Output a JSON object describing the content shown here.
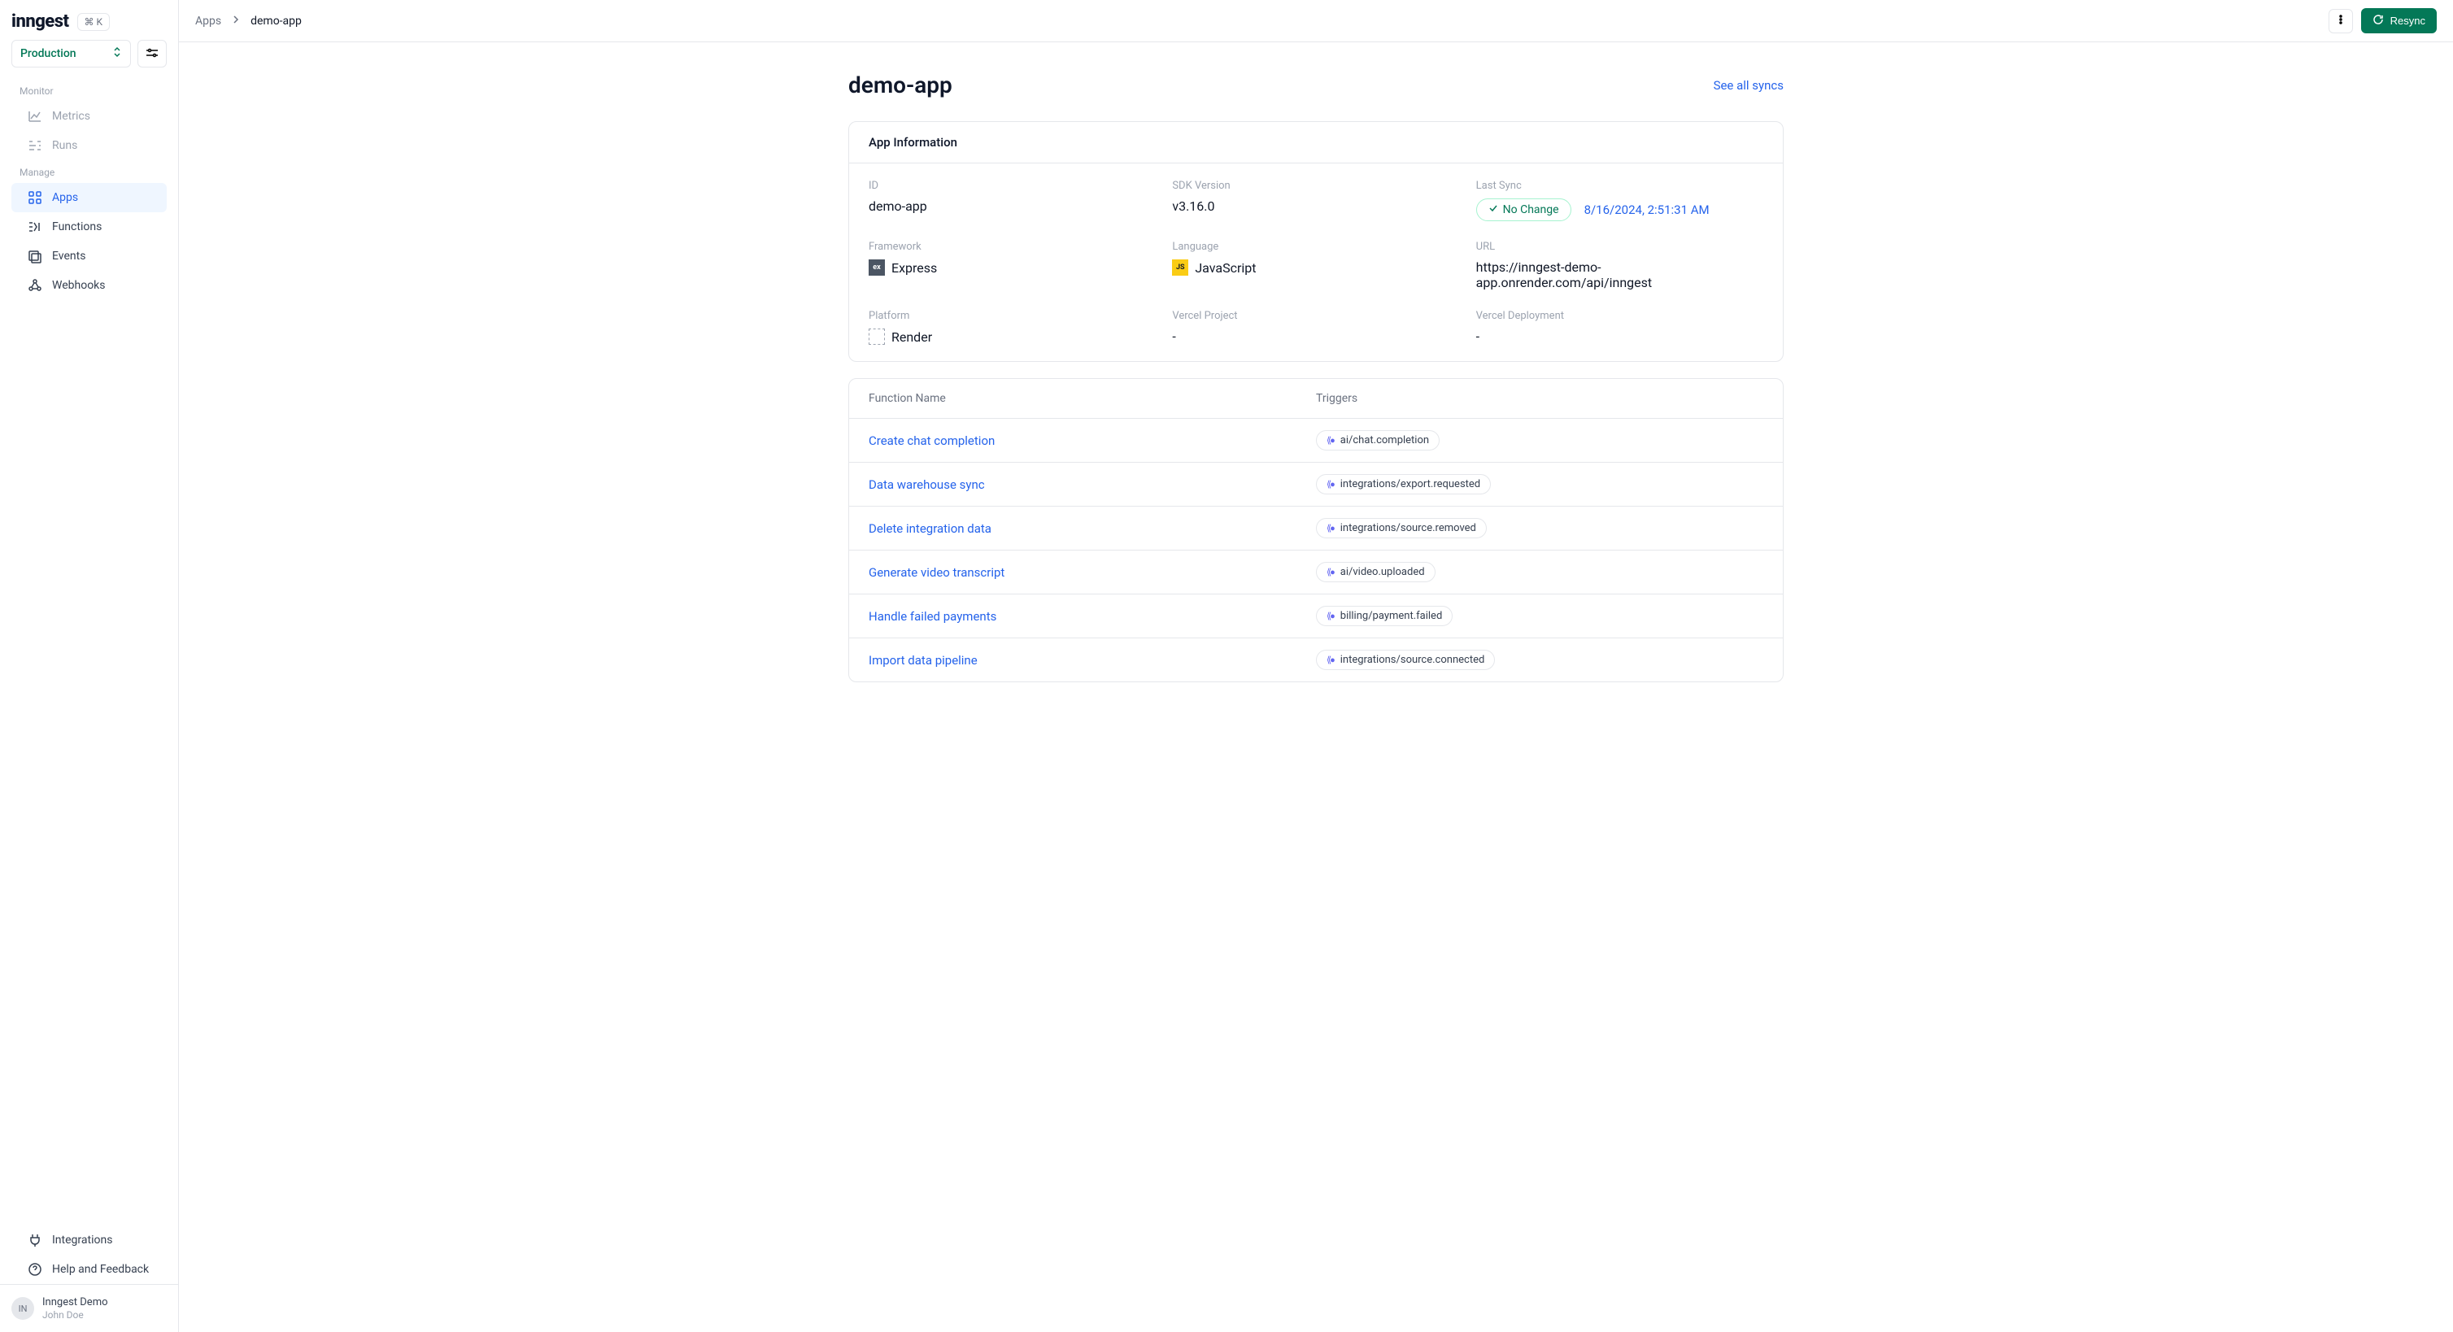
{
  "logo": "inngest",
  "kbd": "⌘ K",
  "env": {
    "selected": "Production"
  },
  "nav": {
    "section_monitor": "Monitor",
    "section_manage": "Manage",
    "metrics": "Metrics",
    "runs": "Runs",
    "apps": "Apps",
    "functions": "Functions",
    "events": "Events",
    "webhooks": "Webhooks",
    "integrations": "Integrations",
    "help": "Help and Feedback"
  },
  "user": {
    "avatar": "IN",
    "name": "Inngest Demo",
    "sub": "John Doe"
  },
  "breadcrumb": {
    "root": "Apps",
    "current": "demo-app"
  },
  "actions": {
    "resync": "Resync"
  },
  "page": {
    "title": "demo-app",
    "see_all_syncs": "See all syncs"
  },
  "info": {
    "header": "App Information",
    "labels": {
      "id": "ID",
      "sdk": "SDK Version",
      "last_sync": "Last Sync",
      "framework": "Framework",
      "language": "Language",
      "url": "URL",
      "platform": "Platform",
      "vercel_project": "Vercel Project",
      "vercel_deploy": "Vercel Deployment"
    },
    "values": {
      "id": "demo-app",
      "sdk": "v3.16.0",
      "sync_status": "No Change",
      "sync_time": "8/16/2024, 2:51:31 AM",
      "framework": "Express",
      "framework_badge": "ex",
      "language": "JavaScript",
      "language_badge": "JS",
      "url": "https://inngest-demo-app.onrender.com/api/inngest",
      "platform": "Render",
      "vercel_project": "-",
      "vercel_deploy": "-"
    }
  },
  "table": {
    "col_name": "Function Name",
    "col_triggers": "Triggers",
    "rows": [
      {
        "name": "Create chat completion",
        "trigger": "ai/chat.completion"
      },
      {
        "name": "Data warehouse sync",
        "trigger": "integrations/export.requested"
      },
      {
        "name": "Delete integration data",
        "trigger": "integrations/source.removed"
      },
      {
        "name": "Generate video transcript",
        "trigger": "ai/video.uploaded"
      },
      {
        "name": "Handle failed payments",
        "trigger": "billing/payment.failed"
      },
      {
        "name": "Import data pipeline",
        "trigger": "integrations/source.connected"
      }
    ]
  }
}
